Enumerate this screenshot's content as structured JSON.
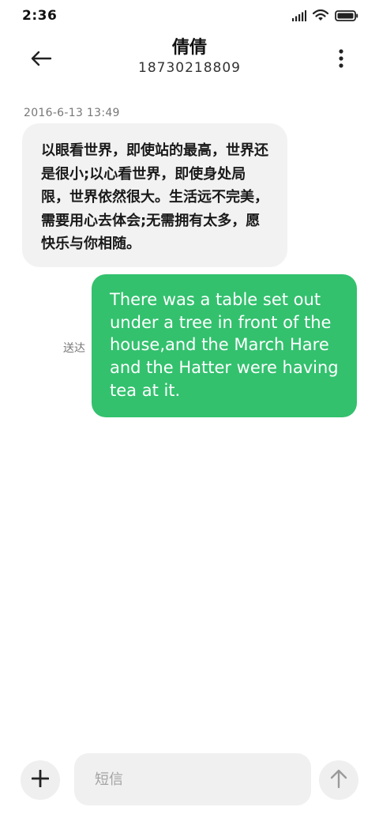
{
  "status_bar": {
    "time": "2:36",
    "icons": [
      "signal-icon",
      "wifi-icon",
      "battery-icon"
    ]
  },
  "header": {
    "contact_name": "倩倩",
    "contact_number": "18730218809",
    "back_icon": "arrow-left-icon",
    "more_icon": "more-vertical-icon"
  },
  "conversation": {
    "timestamp": "2016-6-13 13:49",
    "incoming_message": "以眼看世界，即使站的最高，世界还是很小;以心看世界，即使身处局限，世界依然很大。生活远不完美，需要用心去体会;无需拥有太多，愿快乐与你相随。",
    "outgoing_status": "送达",
    "outgoing_message": "There was a table set out under a tree in front of the house,and the March Hare and the Hatter were having tea at it."
  },
  "composer": {
    "placeholder": "短信",
    "value": "",
    "add_icon": "plus-icon",
    "send_icon": "arrow-up-icon"
  },
  "colors": {
    "outgoing_bubble": "#33c16e",
    "incoming_bubble": "#f2f2f2",
    "background": "#ffffff"
  }
}
